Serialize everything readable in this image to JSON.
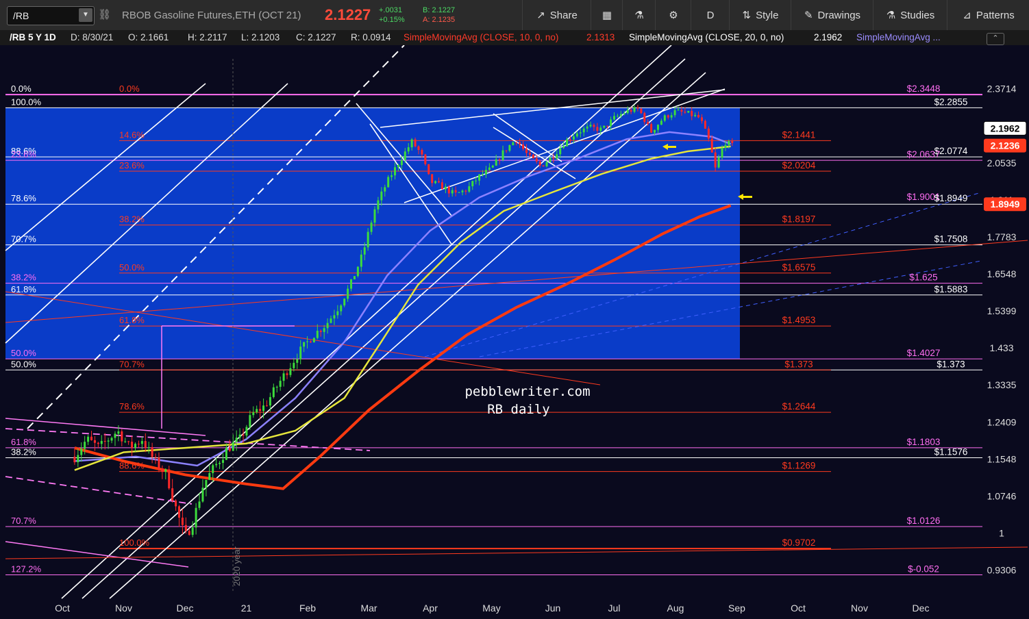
{
  "toolbar": {
    "symbol": "/RB",
    "description": "RBOB Gasoline Futures,ETH (OCT 21)",
    "last": "2.1227",
    "change": "+.0031",
    "change_pct": "+0.15%",
    "bid": "B: 2.1227",
    "ask": "A: 2.1235",
    "share_label": "Share",
    "period_label": "D",
    "style_label": "Style",
    "drawings_label": "Drawings",
    "studies_label": "Studies",
    "patterns_label": "Patterns"
  },
  "info": {
    "title": "/RB 5 Y 1D",
    "date": "D: 8/30/21",
    "open": "O: 2.1661",
    "high": "H: 2.2117",
    "low": "L: 2.1203",
    "close": "C: 2.1227",
    "range": "R: 0.0914",
    "sma10_label": "SimpleMovingAvg (CLOSE, 10, 0, no)",
    "sma10_value": "2.1313",
    "sma20_label": "SimpleMovingAvg (CLOSE, 20, 0, no)",
    "sma20_value": "2.1962",
    "sma_more_label": "SimpleMovingAvg ..."
  },
  "colors": {
    "background": "#0a0a1e",
    "blue_box": "#0a3cc8",
    "price_red": "#ff2a14",
    "fib_red": "#ff3a1e",
    "fib_magenta": "#ff6ef2",
    "sma_yellow": "#e6e63c",
    "sma_red": "#ff3a10",
    "sma_lavender": "#8c82ff",
    "candle_up": "#3cdc3c",
    "candle_down": "#ff2828",
    "annotation_yellow": "#ffe600"
  },
  "watermark": {
    "line1": "pebblewriter.com",
    "line2": "RB daily"
  },
  "chart_data": {
    "type": "candlestick",
    "title": "/RB 5 Y 1D",
    "x_labels": [
      "Oct",
      "Nov",
      "Dec",
      "21",
      "Feb",
      "Mar",
      "Apr",
      "May",
      "Jun",
      "Jul",
      "Aug",
      "Sep",
      "Oct",
      "Nov",
      "Dec"
    ],
    "year_marker": "2020 year",
    "y_ticks": [
      "2.3714",
      "2.0535",
      "1.911",
      "1.7783",
      "1.6548",
      "1.5399",
      "1.433",
      "1.3335",
      "1.2409",
      "1.1548",
      "1.0746",
      "1",
      "0.9306"
    ],
    "ylim": [
      0.89,
      2.48
    ],
    "grid": false,
    "price_badges": [
      {
        "value": "2.1962",
        "style": "white"
      },
      {
        "value": "2.1236",
        "style": "red"
      },
      {
        "value": "1.8949",
        "style": "red"
      }
    ],
    "fib_left_white": [
      {
        "label": "0.0%",
        "value": 2.3448
      },
      {
        "label": "100.0%",
        "value": 2.2855
      },
      {
        "label": "88.6%",
        "value": 2.0774
      },
      {
        "label": "78.6%",
        "value": 1.8949
      },
      {
        "label": "70.7%",
        "value": 1.7508
      },
      {
        "label": "61.8%",
        "value": 1.5883
      },
      {
        "label": "50.0%",
        "value": 1.373
      },
      {
        "label": "38.2%",
        "value": 1.1576
      }
    ],
    "fib_left_magenta": [
      {
        "label": "23.6%",
        "value": 2.0637
      },
      {
        "label": "38.2%",
        "value": 1.625
      },
      {
        "label": "50.0%",
        "value": 1.4027
      },
      {
        "label": "61.8%",
        "value": 1.1803
      },
      {
        "label": "70.7%",
        "value": 1.0126
      },
      {
        "label": "127.2%",
        "value": 0.922
      }
    ],
    "fib_mid_red": [
      {
        "label": "0.0%",
        "value": 2.3448
      },
      {
        "label": "14.6%",
        "value": 2.1441
      },
      {
        "label": "23.6%",
        "value": 2.0204
      },
      {
        "label": "38.2%",
        "value": 1.8197
      },
      {
        "label": "50.0%",
        "value": 1.6575
      },
      {
        "label": "61.8%",
        "value": 1.4953
      },
      {
        "label": "70.7%",
        "value": 1.373
      },
      {
        "label": "78.6%",
        "value": 1.2644
      },
      {
        "label": "88.6%",
        "value": 1.1269
      },
      {
        "label": "100.0%",
        "value": 0.9702
      }
    ],
    "right_labels": [
      {
        "text": "$2.3448",
        "value": 2.3448,
        "color": "magenta"
      },
      {
        "text": "$2.2855",
        "value": 2.2855,
        "color": "white"
      },
      {
        "text": "$2.1441",
        "value": 2.1441,
        "color": "red"
      },
      {
        "text": "$2.0774",
        "value": 2.0774,
        "color": "white"
      },
      {
        "text": "$2.0637",
        "value": 2.0637,
        "color": "magenta"
      },
      {
        "text": "$2.0204",
        "value": 2.0204,
        "color": "red"
      },
      {
        "text": "$1.9001",
        "value": 1.9001,
        "color": "magenta"
      },
      {
        "text": "$1.8949",
        "value": 1.8949,
        "color": "white"
      },
      {
        "text": "$1.8197",
        "value": 1.8197,
        "color": "red"
      },
      {
        "text": "$1.7508",
        "value": 1.7508,
        "color": "white"
      },
      {
        "text": "$1.6575",
        "value": 1.6575,
        "color": "red"
      },
      {
        "text": "$1.625",
        "value": 1.625,
        "color": "magenta"
      },
      {
        "text": "$1.5883",
        "value": 1.5883,
        "color": "white"
      },
      {
        "text": "$1.4953",
        "value": 1.4953,
        "color": "red"
      },
      {
        "text": "$1.4027",
        "value": 1.4027,
        "color": "magenta"
      },
      {
        "text": "$1.373",
        "value": 1.373,
        "color": "red"
      },
      {
        "text": "$1.373",
        "value": 1.373,
        "color": "white"
      },
      {
        "text": "$1.2644",
        "value": 1.2644,
        "color": "red"
      },
      {
        "text": "$1.1803",
        "value": 1.1803,
        "color": "magenta"
      },
      {
        "text": "$1.1576",
        "value": 1.1576,
        "color": "white"
      },
      {
        "text": "$1.1269",
        "value": 1.1269,
        "color": "red"
      },
      {
        "text": "$1.0126",
        "value": 1.0126,
        "color": "magenta"
      },
      {
        "text": "$0.9702",
        "value": 0.9702,
        "color": "red"
      },
      {
        "text": "$-0.052",
        "value": 0.922,
        "color": "magenta"
      }
    ],
    "price_path": [
      [
        0.2,
        1.16
      ],
      [
        0.4,
        1.2
      ],
      [
        0.6,
        1.18
      ],
      [
        0.9,
        1.22
      ],
      [
        1.1,
        1.18
      ],
      [
        1.3,
        1.2
      ],
      [
        1.5,
        1.15
      ],
      [
        1.7,
        1.12
      ],
      [
        1.85,
        1.05
      ],
      [
        2.0,
        0.99
      ],
      [
        2.15,
        1.03
      ],
      [
        2.3,
        1.1
      ],
      [
        2.5,
        1.14
      ],
      [
        2.7,
        1.18
      ],
      [
        2.9,
        1.2
      ],
      [
        3.1,
        1.26
      ],
      [
        3.3,
        1.28
      ],
      [
        3.5,
        1.33
      ],
      [
        3.7,
        1.38
      ],
      [
        3.9,
        1.43
      ],
      [
        4.1,
        1.47
      ],
      [
        4.3,
        1.5
      ],
      [
        4.5,
        1.55
      ],
      [
        4.7,
        1.62
      ],
      [
        4.9,
        1.72
      ],
      [
        5.1,
        1.88
      ],
      [
        5.3,
        1.98
      ],
      [
        5.5,
        2.06
      ],
      [
        5.7,
        2.14
      ],
      [
        5.85,
        2.09
      ],
      [
        6.0,
        1.98
      ],
      [
        6.2,
        1.96
      ],
      [
        6.4,
        1.93
      ],
      [
        6.6,
        1.95
      ],
      [
        6.8,
        2.0
      ],
      [
        7.0,
        2.03
      ],
      [
        7.2,
        2.1
      ],
      [
        7.4,
        2.15
      ],
      [
        7.6,
        2.08
      ],
      [
        7.8,
        2.04
      ],
      [
        8.0,
        2.08
      ],
      [
        8.2,
        2.14
      ],
      [
        8.4,
        2.18
      ],
      [
        8.6,
        2.2
      ],
      [
        8.8,
        2.19
      ],
      [
        9.0,
        2.24
      ],
      [
        9.2,
        2.27
      ],
      [
        9.4,
        2.28
      ],
      [
        9.6,
        2.18
      ],
      [
        9.8,
        2.24
      ],
      [
        10.0,
        2.27
      ],
      [
        10.2,
        2.26
      ],
      [
        10.4,
        2.24
      ],
      [
        10.55,
        2.14
      ],
      [
        10.65,
        2.03
      ],
      [
        10.8,
        2.14
      ],
      [
        10.95,
        2.12
      ]
    ],
    "sma_yellow_path": [
      [
        0.2,
        1.13
      ],
      [
        1.0,
        1.17
      ],
      [
        2.0,
        1.18
      ],
      [
        3.0,
        1.19
      ],
      [
        3.8,
        1.22
      ],
      [
        4.6,
        1.3
      ],
      [
        5.2,
        1.45
      ],
      [
        5.8,
        1.62
      ],
      [
        6.5,
        1.76
      ],
      [
        7.2,
        1.87
      ],
      [
        8.0,
        1.94
      ],
      [
        8.8,
        2.01
      ],
      [
        9.6,
        2.07
      ],
      [
        10.2,
        2.1
      ],
      [
        10.9,
        2.12
      ]
    ],
    "sma_red_path": [
      [
        0.2,
        1.18
      ],
      [
        1.0,
        1.15
      ],
      [
        2.0,
        1.12
      ],
      [
        3.0,
        1.1
      ],
      [
        3.6,
        1.09
      ],
      [
        4.2,
        1.16
      ],
      [
        5.0,
        1.27
      ],
      [
        5.8,
        1.37
      ],
      [
        6.6,
        1.47
      ],
      [
        7.4,
        1.55
      ],
      [
        8.2,
        1.62
      ],
      [
        9.0,
        1.7
      ],
      [
        9.8,
        1.79
      ],
      [
        10.4,
        1.85
      ],
      [
        10.9,
        1.89
      ]
    ],
    "sma_lavender_path": [
      [
        0.2,
        1.15
      ],
      [
        1.2,
        1.16
      ],
      [
        2.2,
        1.14
      ],
      [
        3.0,
        1.2
      ],
      [
        3.8,
        1.3
      ],
      [
        4.6,
        1.45
      ],
      [
        5.3,
        1.65
      ],
      [
        6.0,
        1.8
      ],
      [
        6.8,
        1.92
      ],
      [
        7.6,
        2.0
      ],
      [
        8.4,
        2.07
      ],
      [
        9.2,
        2.15
      ],
      [
        9.9,
        2.18
      ],
      [
        10.6,
        2.16
      ],
      [
        10.9,
        2.13
      ]
    ]
  }
}
